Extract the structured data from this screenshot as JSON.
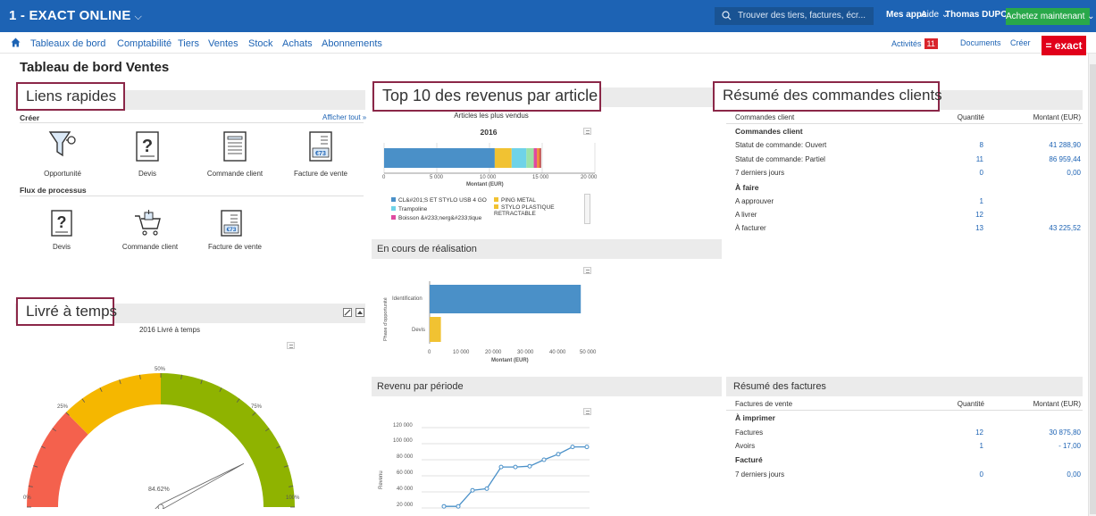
{
  "topbar": {
    "title": "1 - EXACT ONLINE",
    "search_placeholder": "Trouver des tiers, factures, écr...",
    "apps": "Mes apps",
    "help": "Aide",
    "user": "Thomas DUPOND",
    "buy": "Achetez maintenant"
  },
  "nav": {
    "items": [
      "Tableaux de bord",
      "Comptabilité",
      "Tiers",
      "Ventes",
      "Stock",
      "Achats",
      "Abonnements"
    ],
    "activities": "Activités",
    "activities_count": "11",
    "documents": "Documents",
    "create": "Créer",
    "logo": "= exact"
  },
  "page_title": "Tableau de bord Ventes",
  "quick_links": {
    "title": "Liens rapides",
    "create_label": "Créer",
    "show_all": "Afficher tout »",
    "create_items": [
      "Opportunité",
      "Devis",
      "Commande client",
      "Facture de vente"
    ],
    "process_label": "Flux de processus",
    "process_items": [
      "Devis",
      "Commande client",
      "Facture de vente"
    ]
  },
  "ontime": {
    "title": "Livré à temps",
    "chart_title": "2016 Livré à temps",
    "ticks": [
      "0%",
      "25%",
      "50%",
      "75%",
      "100%"
    ],
    "value_label": "84.62%"
  },
  "top10": {
    "title": "Top 10 des revenus par article",
    "subtitle": "Articles les plus vendus",
    "year": "2016",
    "xticks": [
      "0",
      "5 000",
      "10 000",
      "15 000",
      "20 000"
    ],
    "xlabel": "Montant (EUR)",
    "legend": [
      {
        "name": "CL&#201;S ET STYLO USB 4 GO",
        "color": "#4a90c8"
      },
      {
        "name": "PING METAL",
        "color": "#f1c232"
      },
      {
        "name": "Trampoline",
        "color": "#6fd3e8"
      },
      {
        "name": "STYLO PLASTIQUE RETRACTABLE",
        "color": "#f1c232"
      },
      {
        "name": "Boisson &#233;nerg&#233;tique",
        "color": "#e04aa0"
      }
    ]
  },
  "in_progress": {
    "title": "En cours de réalisation",
    "ylabel": "Phase d'opportunité",
    "xlabel": "Montant (EUR)",
    "xticks": [
      "0",
      "10 000",
      "20 000",
      "30 000",
      "40 000",
      "50 000"
    ]
  },
  "revenue_period": {
    "title": "Revenu par période",
    "ylabel": "Revenu",
    "yticks": [
      "120 000",
      "100 000",
      "80 000",
      "60 000",
      "40 000",
      "20 000"
    ]
  },
  "orders_summary": {
    "title": "Résumé des commandes clients",
    "col1": "Commandes client",
    "col2": "Quantité",
    "col3": "Montant (EUR)",
    "group1": "Commandes client",
    "rows1": [
      {
        "label": "Statut de commande: Ouvert",
        "qty": "8",
        "amount": "41 288,90"
      },
      {
        "label": "Statut de commande: Partiel",
        "qty": "11",
        "amount": "86 959,44"
      },
      {
        "label": "7 derniers jours",
        "qty": "0",
        "amount": "0,00"
      }
    ],
    "group2": "À faire",
    "rows2": [
      {
        "label": "A approuver",
        "qty": "1",
        "amount": ""
      },
      {
        "label": "A livrer",
        "qty": "12",
        "amount": ""
      },
      {
        "label": "À facturer",
        "qty": "13",
        "amount": "43 225,52"
      }
    ]
  },
  "invoices_summary": {
    "title": "Résumé des factures",
    "col1": "Factures de vente",
    "col2": "Quantité",
    "col3": "Montant (EUR)",
    "group1": "À imprimer",
    "rows1": [
      {
        "label": "Factures",
        "qty": "12",
        "amount": "30 875,80"
      },
      {
        "label": "Avoirs",
        "qty": "1",
        "amount": "- 17,00"
      }
    ],
    "group2": "Facturé",
    "rows2": [
      {
        "label": "7 derniers jours",
        "qty": "0",
        "amount": "0,00"
      }
    ]
  },
  "chart_data": [
    {
      "type": "bar",
      "title": "Articles les plus vendus",
      "subtitle": "2016",
      "xlabel": "Montant (EUR)",
      "xlim": [
        0,
        20000
      ],
      "stacked": true,
      "series": [
        {
          "name": "CL&#201;S ET STYLO USB 4 GO",
          "values": [
            10500
          ],
          "color": "#4a90c8"
        },
        {
          "name": "PING METAL",
          "values": [
            1600
          ],
          "color": "#f1c232"
        },
        {
          "name": "Trampoline",
          "values": [
            1400
          ],
          "color": "#6fd3e8"
        },
        {
          "values": [
            700
          ],
          "color": "#9be2a8"
        },
        {
          "values": [
            300
          ],
          "color": "#e04aa0"
        },
        {
          "values": [
            250
          ],
          "color": "#f08a3c"
        },
        {
          "values": [
            150
          ],
          "color": "#c0504d"
        }
      ]
    },
    {
      "type": "bar",
      "orientation": "horizontal",
      "categories": [
        "Identification",
        "Devis"
      ],
      "values": [
        47000,
        3500
      ],
      "colors": [
        "#4a90c8",
        "#f1c232"
      ],
      "xlabel": "Montant (EUR)",
      "ylabel": "Phase d'opportunité",
      "xlim": [
        0,
        50000
      ]
    },
    {
      "type": "line",
      "ylabel": "Revenu",
      "ylim": [
        20000,
        120000
      ],
      "x": [
        1,
        2,
        3,
        4,
        5,
        6,
        7,
        8,
        9,
        10,
        11
      ],
      "values": [
        22000,
        22000,
        42000,
        44000,
        71000,
        71000,
        72000,
        80000,
        87000,
        96000,
        96000
      ],
      "color": "#4a90c8"
    },
    {
      "type": "gauge",
      "title": "2016 Livré à temps",
      "min": 0,
      "max": 100,
      "value": 84.62,
      "bands": [
        {
          "from": 0,
          "to": 25,
          "color": "#f4614d"
        },
        {
          "from": 25,
          "to": 50,
          "color": "#f5b700"
        },
        {
          "from": 50,
          "to": 100,
          "color": "#8fb300"
        }
      ]
    }
  ]
}
